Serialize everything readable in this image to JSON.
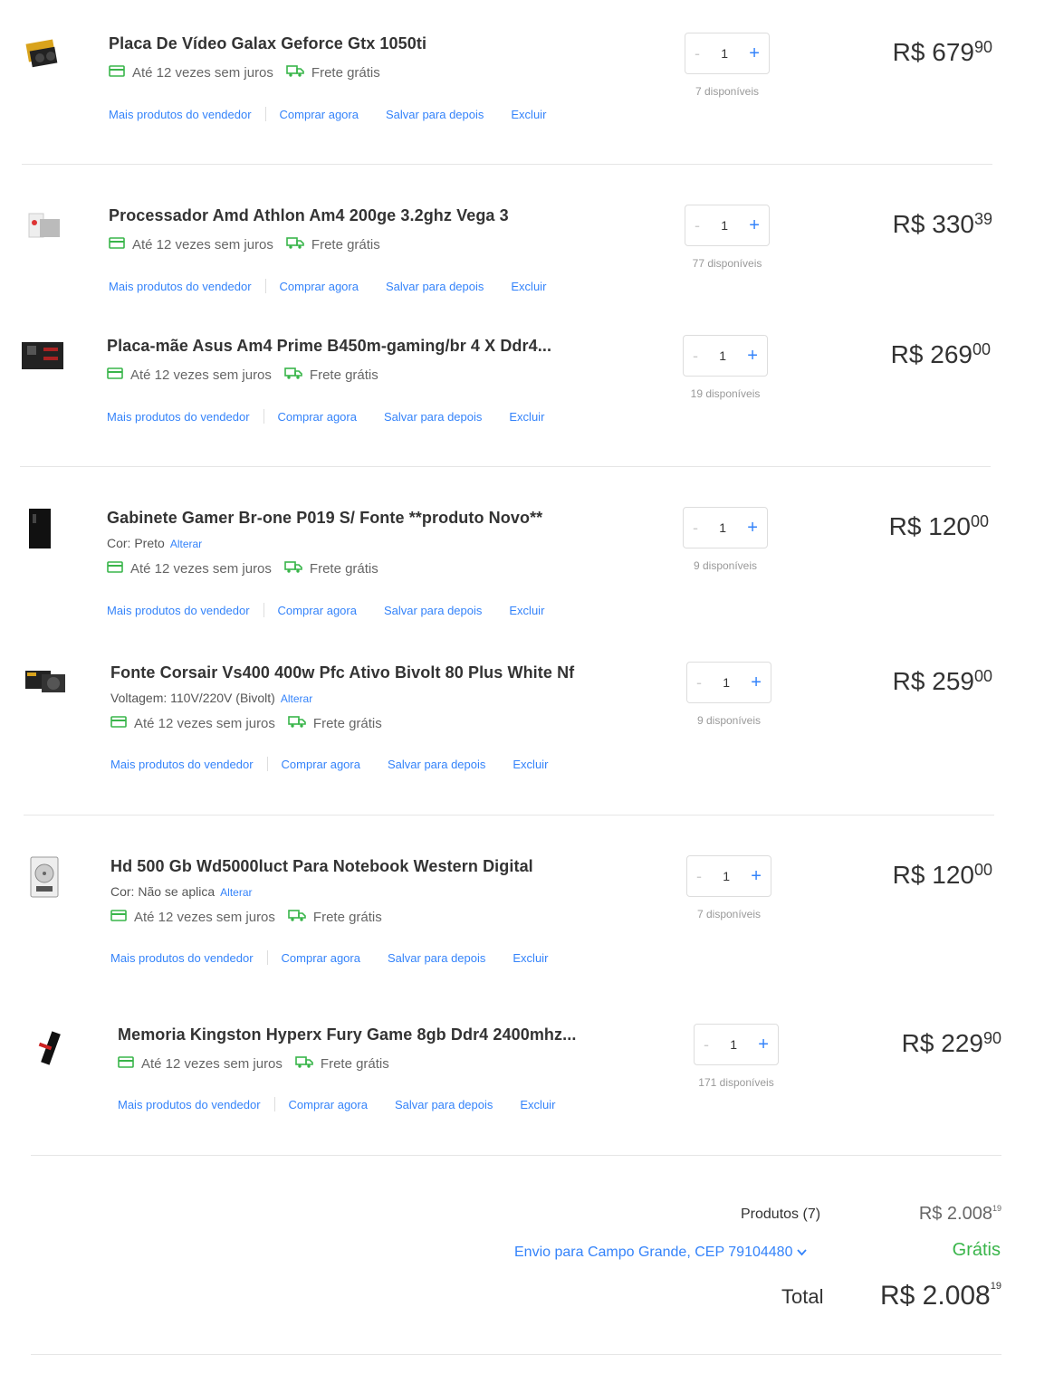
{
  "items": [
    {
      "title": "Placa De Vídeo Galax Geforce Gtx 1050ti",
      "variant_label": "",
      "variant_change": "",
      "installments": "Até 12 vezes sem juros",
      "shipping": "Frete grátis",
      "qty": "1",
      "available": "7 disponíveis",
      "price_int": "R$ 679",
      "price_cents": "90",
      "icon": "gpu-image"
    },
    {
      "title": "Processador Amd Athlon Am4 200ge 3.2ghz Vega 3",
      "variant_label": "",
      "variant_change": "",
      "installments": "Até 12 vezes sem juros",
      "shipping": "Frete grátis",
      "qty": "1",
      "available": "77 disponíveis",
      "price_int": "R$ 330",
      "price_cents": "39",
      "icon": "cpu-image"
    },
    {
      "title": "Placa-mãe Asus Am4 Prime B450m-gaming/br 4 X Ddr4...",
      "variant_label": "",
      "variant_change": "",
      "installments": "Até 12 vezes sem juros",
      "shipping": "Frete grátis",
      "qty": "1",
      "available": "19 disponíveis",
      "price_int": "R$ 269",
      "price_cents": "00",
      "icon": "motherboard-image"
    },
    {
      "title": "Gabinete Gamer Br-one P019 S/ Fonte **produto Novo**",
      "variant_label": "Cor: Preto",
      "variant_change": "Alterar",
      "installments": "Até 12 vezes sem juros",
      "shipping": "Frete grátis",
      "qty": "1",
      "available": "9 disponíveis",
      "price_int": "R$ 120",
      "price_cents": "00",
      "icon": "case-image"
    },
    {
      "title": "Fonte Corsair Vs400 400w Pfc Ativo Bivolt 80 Plus White Nf",
      "variant_label": "Voltagem: 110V/220V (Bivolt)",
      "variant_change": "Alterar",
      "installments": "Até 12 vezes sem juros",
      "shipping": "Frete grátis",
      "qty": "1",
      "available": "9 disponíveis",
      "price_int": "R$ 259",
      "price_cents": "00",
      "icon": "psu-image"
    },
    {
      "title": "Hd 500 Gb Wd5000luct Para Notebook Western Digital",
      "variant_label": "Cor: Não se aplica",
      "variant_change": "Alterar",
      "installments": "Até 12 vezes sem juros",
      "shipping": "Frete grátis",
      "qty": "1",
      "available": "7 disponíveis",
      "price_int": "R$ 120",
      "price_cents": "00",
      "icon": "hdd-image"
    },
    {
      "title": "Memoria Kingston Hyperx Fury Game 8gb Ddr4 2400mhz...",
      "variant_label": "",
      "variant_change": "",
      "installments": "Até 12 vezes sem juros",
      "shipping": "Frete grátis",
      "qty": "1",
      "available": "171 disponíveis",
      "price_int": "R$ 229",
      "price_cents": "90",
      "icon": "ram-image"
    }
  ],
  "actions": {
    "more_from_seller": "Mais produtos do vendedor",
    "buy_now": "Comprar agora",
    "save_for_later": "Salvar para depois",
    "delete": "Excluir"
  },
  "qty_controls": {
    "minus": "-",
    "plus": "+"
  },
  "summary": {
    "products_label": "Produtos (7)",
    "products_int": "R$ 2.008",
    "products_cents": "19",
    "shipping_label": "Envio para Campo Grande, CEP 79104480",
    "shipping_value": "Grátis",
    "total_label": "Total",
    "total_int": "R$ 2.008",
    "total_cents": "19"
  },
  "colors": {
    "link": "#3483fa",
    "green": "#39b54a",
    "text": "#333333",
    "muted": "#999999"
  }
}
